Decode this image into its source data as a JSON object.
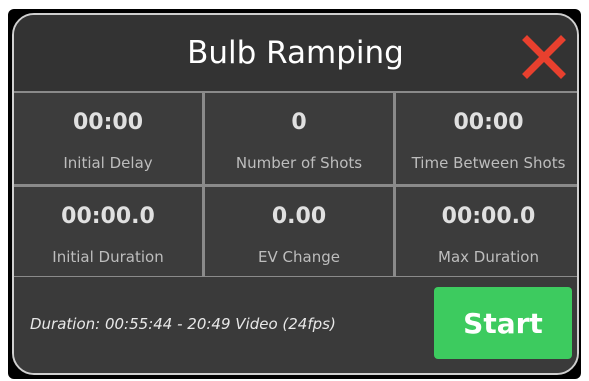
{
  "dialog": {
    "title": "Bulb Ramping",
    "close_icon": "close-x-icon",
    "colors": {
      "close": "#e8402e",
      "start": "#3dcb5f",
      "background": "#3a3a3a"
    }
  },
  "settings": [
    {
      "value": "00:00",
      "label": "Initial Delay"
    },
    {
      "value": "0",
      "label": "Number of Shots"
    },
    {
      "value": "00:00",
      "label": "Time Between Shots"
    },
    {
      "value": "00:00.0",
      "label": "Initial Duration"
    },
    {
      "value": "0.00",
      "label": "EV Change"
    },
    {
      "value": "00:00.0",
      "label": "Max Duration"
    }
  ],
  "footer": {
    "duration_text": "Duration: 00:55:44 - 20:49 Video (24fps)",
    "start_label": "Start"
  }
}
